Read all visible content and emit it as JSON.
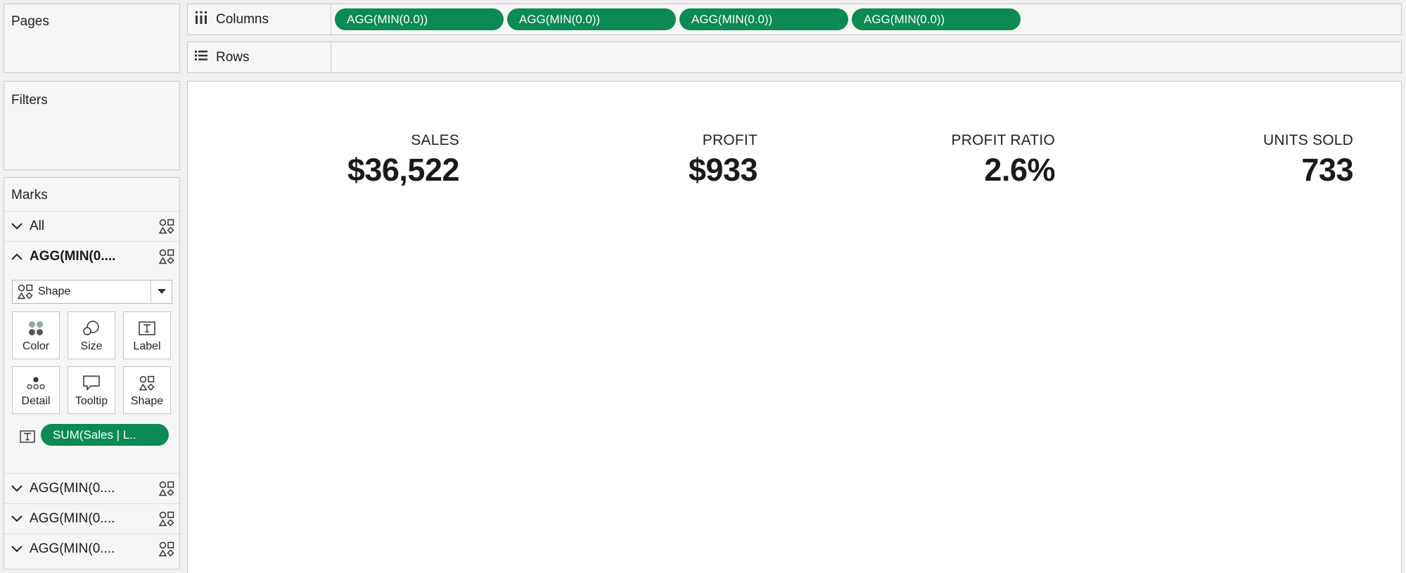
{
  "pages": {
    "title": "Pages"
  },
  "filters": {
    "title": "Filters"
  },
  "marks": {
    "title": "Marks",
    "rows": [
      {
        "label": "All",
        "expanded": false,
        "icon": "shapes-icon"
      },
      {
        "label": "AGG(MIN(0....",
        "expanded": true,
        "icon": "shapes-icon"
      }
    ],
    "mark_type": "Shape",
    "buttons": [
      "Color",
      "Size",
      "Label",
      "Detail",
      "Tooltip",
      "Shape"
    ],
    "label_pill": "SUM(Sales | L..",
    "collapsed_rows": [
      "AGG(MIN(0....",
      "AGG(MIN(0....",
      "AGG(MIN(0...."
    ]
  },
  "columns": {
    "label": "Columns",
    "pills": [
      "AGG(MIN(0.0))",
      "AGG(MIN(0.0))",
      "AGG(MIN(0.0))",
      "AGG(MIN(0.0))"
    ]
  },
  "rows": {
    "label": "Rows"
  },
  "kpis": [
    {
      "title": "SALES",
      "value": "$36,522"
    },
    {
      "title": "PROFIT",
      "value": "$933"
    },
    {
      "title": "PROFIT RATIO",
      "value": "2.6%"
    },
    {
      "title": "UNITS SOLD",
      "value": "733"
    }
  ],
  "colors": {
    "pill_green": "#0c8a54",
    "panel_bg": "#f6f6f6",
    "border": "#c8c8c8"
  }
}
